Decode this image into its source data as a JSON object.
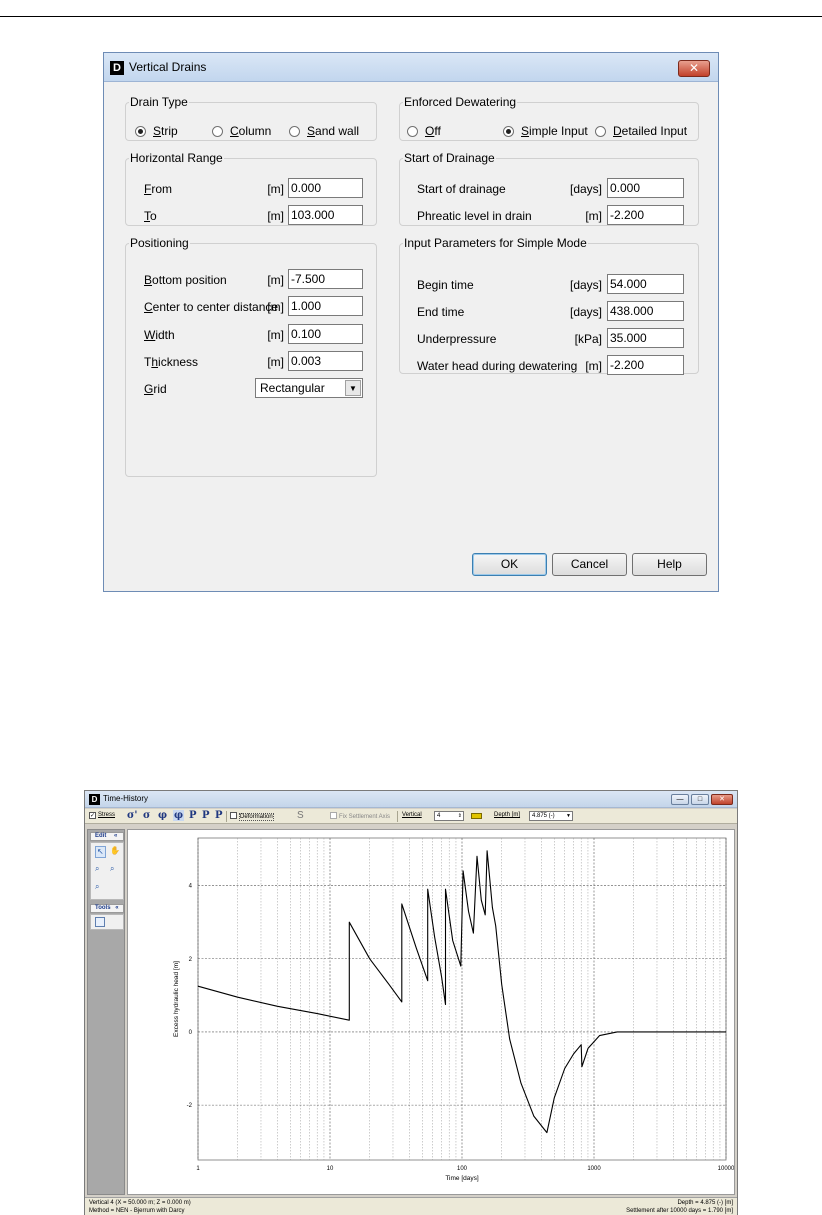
{
  "dialog": {
    "icon_letter": "D",
    "title": "Vertical Drains",
    "close_glyph": "✕",
    "drain_type": {
      "legend": "Drain Type",
      "options": [
        {
          "label": "Strip",
          "accel": "S",
          "rest": "trip",
          "selected": true
        },
        {
          "label": "Column",
          "accel": "C",
          "rest": "olumn",
          "selected": false
        },
        {
          "label": "Sand wall",
          "accel": "S",
          "rest": "and wall",
          "selected": false
        }
      ]
    },
    "enforced_dewatering": {
      "legend": "Enforced Dewatering",
      "options": [
        {
          "label": "Off",
          "accel": "O",
          "rest": "ff",
          "selected": false
        },
        {
          "label": "Simple Input",
          "accel": "S",
          "rest": "imple Input",
          "selected": true
        },
        {
          "label": "Detailed Input",
          "accel": "D",
          "rest": "etailed Input",
          "selected": false
        }
      ]
    },
    "horizontal_range": {
      "legend": "Horizontal Range",
      "from": {
        "accel": "F",
        "rest": "rom",
        "unit": "[m]",
        "value": "0.000"
      },
      "to": {
        "accel": "T",
        "rest": "o",
        "unit": "[m]",
        "value": "103.000"
      }
    },
    "start_of_drainage": {
      "legend": "Start of Drainage",
      "start": {
        "label": "Start of drainage",
        "unit": "[days]",
        "value": "0.000"
      },
      "phreatic": {
        "label": "Phreatic level in drain",
        "unit": "[m]",
        "value": "-2.200"
      }
    },
    "positioning": {
      "legend": "Positioning",
      "bottom": {
        "accel": "B",
        "rest": "ottom position",
        "unit": "[m]",
        "value": "-7.500"
      },
      "ctc": {
        "accel": "C",
        "rest": "enter to center distance",
        "unit": "[m]",
        "value": "1.000"
      },
      "width": {
        "accel": "W",
        "rest": "idth",
        "unit": "[m]",
        "value": "0.100"
      },
      "thickness": {
        "pre": "T",
        "accel": "h",
        "rest": "ickness",
        "unit": "[m]",
        "value": "0.003"
      },
      "grid": {
        "accel": "G",
        "rest": "rid",
        "value": "Rectangular",
        "arrow": "▼"
      }
    },
    "simple_mode": {
      "legend": "Input Parameters for Simple Mode",
      "begin": {
        "label": "Begin time",
        "unit": "[days]",
        "value": "54.000"
      },
      "end": {
        "label": "End time",
        "unit": "[days]",
        "value": "438.000"
      },
      "underpressure": {
        "label": "Underpressure",
        "unit": "[kPa]",
        "value": "35.000"
      },
      "water_head": {
        "label": "Water head during dewatering",
        "unit": "[m]",
        "value": "-2.200"
      }
    },
    "buttons": {
      "ok": "OK",
      "cancel": "Cancel",
      "help": "Help"
    }
  },
  "time_history": {
    "icon_letter": "D",
    "title": "Time-History",
    "window_buttons": {
      "min": "—",
      "max": "□",
      "close": "✕"
    },
    "toolbar": {
      "stress_label": "Stress",
      "stress_checked": true,
      "symbols": [
        "σ'",
        "σ",
        "φ",
        "φ",
        "P",
        "P",
        "P"
      ],
      "deformation_label": "Deformation",
      "deformation_checked": false,
      "s_label": "S",
      "fix_settlement_label": "Fix Settlement Axis",
      "vertical_label": "Vertical",
      "vertical_value": "4",
      "depth_label": "Depth [m]",
      "depth_value": "4.875 (-)"
    },
    "side_panel": {
      "edit_header": "Edit",
      "tools_header": "Tools",
      "chevron": "«"
    },
    "status": {
      "left1": "Vertical 4 (X = 50.000 m; Z = 0.000 m)",
      "left2": "Method = NEN - Bjerrum with Darcy",
      "right1": "Depth = 4.875 (-) [m]",
      "right2": "Settlement after 10000 days = 1.790 [m]"
    }
  },
  "chart_data": {
    "type": "line",
    "title": "",
    "xlabel": "Time [days]",
    "ylabel": "Excess hydraulic head [m]",
    "x_scale": "log",
    "xlim": [
      1,
      10000
    ],
    "ylim": [
      -3.5,
      5.3
    ],
    "x_ticks": [
      "1",
      "10",
      "100",
      "1000",
      "10000"
    ],
    "y_ticks": [
      "-2",
      "0",
      "2",
      "4"
    ],
    "grid": true,
    "series": [
      {
        "color": "#000000",
        "points": [
          [
            1,
            1.25
          ],
          [
            2,
            0.95
          ],
          [
            4,
            0.7
          ],
          [
            8,
            0.5
          ],
          [
            14,
            0.32
          ],
          [
            14,
            3.0
          ],
          [
            20,
            2.0
          ],
          [
            28,
            1.3
          ],
          [
            35,
            0.82
          ],
          [
            35,
            3.5
          ],
          [
            45,
            2.3
          ],
          [
            55,
            1.4
          ],
          [
            55,
            3.9
          ],
          [
            62,
            2.6
          ],
          [
            70,
            1.5
          ],
          [
            75,
            0.75
          ],
          [
            75,
            3.9
          ],
          [
            85,
            2.5
          ],
          [
            98,
            1.8
          ],
          [
            102,
            4.4
          ],
          [
            112,
            3.3
          ],
          [
            122,
            2.7
          ],
          [
            130,
            4.8
          ],
          [
            140,
            3.6
          ],
          [
            150,
            3.2
          ],
          [
            155,
            4.95
          ],
          [
            162,
            4.2
          ],
          [
            170,
            3.4
          ],
          [
            180,
            2.9
          ],
          [
            200,
            1.3
          ],
          [
            230,
            -0.2
          ],
          [
            280,
            -1.4
          ],
          [
            350,
            -2.3
          ],
          [
            440,
            -2.75
          ],
          [
            500,
            -1.8
          ],
          [
            600,
            -1.0
          ],
          [
            700,
            -0.6
          ],
          [
            800,
            -0.35
          ],
          [
            810,
            -0.95
          ],
          [
            900,
            -0.45
          ],
          [
            1100,
            -0.1
          ],
          [
            1500,
            0.0
          ],
          [
            3000,
            0.0
          ],
          [
            10000,
            0.0
          ]
        ]
      }
    ]
  }
}
